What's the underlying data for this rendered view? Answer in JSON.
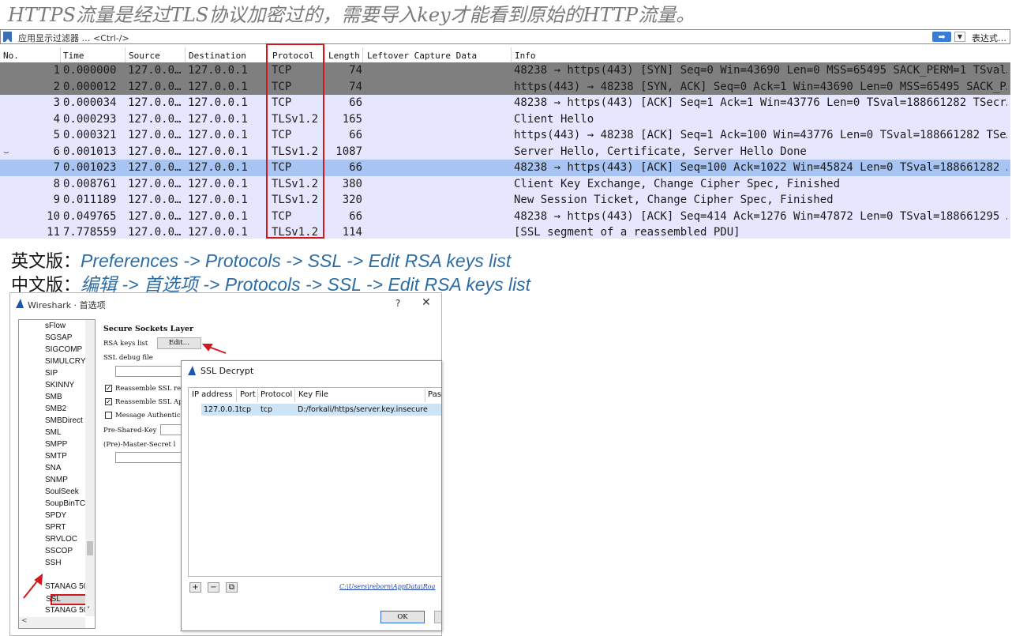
{
  "heading": "HTTPS流量是经过TLS协议加密过的，需要导入key才能看到原始的HTTP流量。",
  "filter": {
    "placeholder": "应用显示过滤器 … <Ctrl-/>",
    "expression_label": "表达式…"
  },
  "packet_list": {
    "columns": [
      "No.",
      "Time",
      "Source",
      "Destination",
      "Protocol",
      "Length",
      "Leftover Capture Data",
      "Info"
    ],
    "rows": [
      {
        "no": "1",
        "time": "0.000000",
        "src": "127.0.0…",
        "dst": "127.0.0.1",
        "proto": "TCP",
        "len": "74",
        "info": "48238 → https(443) [SYN] Seq=0 Win=43690 Len=0 MSS=65495 SACK_PERM=1 TSval…"
      },
      {
        "no": "2",
        "time": "0.000012",
        "src": "127.0.0…",
        "dst": "127.0.0.1",
        "proto": "TCP",
        "len": "74",
        "info": "https(443) → 48238 [SYN, ACK] Seq=0 Ack=1 Win=43690 Len=0 MSS=65495 SACK_P…"
      },
      {
        "no": "3",
        "time": "0.000034",
        "src": "127.0.0…",
        "dst": "127.0.0.1",
        "proto": "TCP",
        "len": "66",
        "info": "48238 → https(443) [ACK] Seq=1 Ack=1 Win=43776 Len=0 TSval=188661282 TSecr…"
      },
      {
        "no": "4",
        "time": "0.000293",
        "src": "127.0.0…",
        "dst": "127.0.0.1",
        "proto": "TLSv1.2",
        "len": "165",
        "info": "Client Hello"
      },
      {
        "no": "5",
        "time": "0.000321",
        "src": "127.0.0…",
        "dst": "127.0.0.1",
        "proto": "TCP",
        "len": "66",
        "info": "https(443) → 48238 [ACK] Seq=1 Ack=100 Win=43776 Len=0 TSval=188661282 TSe…"
      },
      {
        "no": "6",
        "time": "0.001013",
        "src": "127.0.0…",
        "dst": "127.0.0.1",
        "proto": "TLSv1.2",
        "len": "1087",
        "info": "Server Hello, Certificate, Server Hello Done"
      },
      {
        "no": "7",
        "time": "0.001023",
        "src": "127.0.0…",
        "dst": "127.0.0.1",
        "proto": "TCP",
        "len": "66",
        "info": "48238 → https(443) [ACK] Seq=100 Ack=1022 Win=45824 Len=0 TSval=188661282 …"
      },
      {
        "no": "8",
        "time": "0.008761",
        "src": "127.0.0…",
        "dst": "127.0.0.1",
        "proto": "TLSv1.2",
        "len": "380",
        "info": "Client Key Exchange, Change Cipher Spec, Finished"
      },
      {
        "no": "9",
        "time": "0.011189",
        "src": "127.0.0…",
        "dst": "127.0.0.1",
        "proto": "TLSv1.2",
        "len": "320",
        "info": "New Session Ticket, Change Cipher Spec, Finished"
      },
      {
        "no": "10",
        "time": "0.049765",
        "src": "127.0.0…",
        "dst": "127.0.0.1",
        "proto": "TCP",
        "len": "66",
        "info": "48238 → https(443) [ACK] Seq=414 Ack=1276 Win=47872 Len=0 TSval=188661295 …"
      },
      {
        "no": "11",
        "time": "7.778559",
        "src": "127.0.0…",
        "dst": "127.0.0.1",
        "proto": "TLSv1.2",
        "len": "114",
        "info": "[SSL segment of a reassembled PDU]"
      }
    ]
  },
  "instructions": {
    "en_label": "英文版：",
    "en_path": "Preferences -> Protocols -> SSL -> Edit RSA keys list",
    "zh_label": "中文版：",
    "zh_path": "编辑 -> 首选项 -> Protocols -> SSL -> Edit RSA keys list"
  },
  "prefs_window": {
    "title": "Wireshark · 首选项",
    "help": "?",
    "close": "✕",
    "tree_items": [
      "sFlow",
      "SGSAP",
      "SIGCOMP",
      "SIMULCRYI",
      "SIP",
      "SKINNY",
      "SMB",
      "SMB2",
      "SMBDirect",
      "SML",
      "SMPP",
      "SMTP",
      "SNA",
      "SNMP",
      "SoulSeek",
      "SoupBinTC",
      "SPDY",
      "SPRT",
      "SRVLOC",
      "SSCOP",
      "SSH",
      "SSL",
      "STANAG 50",
      "STANAG 50"
    ],
    "section_title": "Secure Sockets Layer",
    "rsa_label": "RSA keys list",
    "edit_button": "Edit…",
    "debug_label": "SSL debug file",
    "reassemble1": "Reassemble SSL re",
    "reassemble2": "Reassemble SSL App",
    "message_auth": "Message Authentic",
    "psk_label": "Pre-Shared-Key",
    "master_label": "(Pre)-Master-Secret l"
  },
  "ssl_dialog": {
    "title": "SSL Decrypt",
    "columns": [
      "IP address",
      "Port",
      "Protocol",
      "Key File",
      "Pass"
    ],
    "row": {
      "ip": "127.0.0.1",
      "port": "tcp",
      "protocol": "tcp",
      "key_file": "D:/forkali/https/server.key.insecure"
    },
    "add": "+",
    "remove": "−",
    "copy": "⧉",
    "path": "C:\\Users\\reborn\\AppData\\Roa",
    "ok": "OK"
  },
  "colors": {
    "highlight_red": "#d0191e",
    "path_blue": "#2e6da4",
    "row_tcp": "#e7e6ff",
    "row_selected": "#a8c4f2",
    "row_dark": "#7f7f7f"
  }
}
